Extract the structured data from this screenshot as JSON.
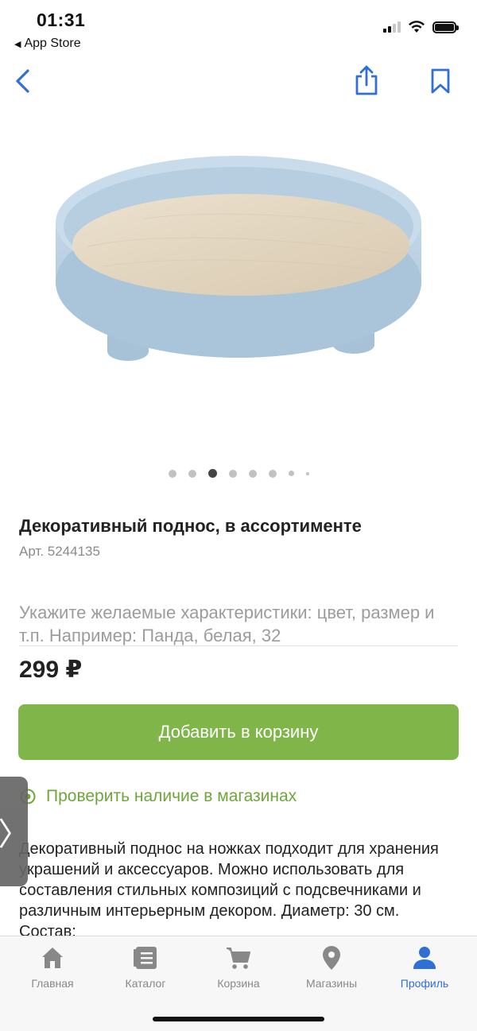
{
  "status_bar": {
    "time": "01:31",
    "back_app": "App Store"
  },
  "nav": {
    "back_icon": "chevron-left-icon",
    "share_icon": "share-icon",
    "bookmark_icon": "bookmark-icon",
    "accent_color": "#2f6fd6"
  },
  "carousel": {
    "total": 8,
    "active_index": 3
  },
  "product": {
    "title": "Декоративный поднос, в ассортименте",
    "article": "Арт. 5244135",
    "characteristics_placeholder": "Укажите желаемые характеристики: цвет, размер и т.п. Например: Панда, белая, 32",
    "price": "299 ₽"
  },
  "actions": {
    "add_to_cart": "Добавить в корзину",
    "check_availability": "Проверить наличие в магазинах",
    "button_color": "#80b54a"
  },
  "description": "Декоративный поднос на ножках подходит для хранения украшений и аксессуаров. Можно использовать для составления стильных композиций с подсвечниками и различным интерьерным декором. Диаметр: 30 см. Состав:",
  "side_handle": "〉",
  "tab_bar": {
    "tabs": [
      {
        "label": "Главная",
        "icon": "home-icon"
      },
      {
        "label": "Каталог",
        "icon": "catalog-icon"
      },
      {
        "label": "Корзина",
        "icon": "cart-icon"
      },
      {
        "label": "Магазины",
        "icon": "location-pin-icon"
      },
      {
        "label": "Профиль",
        "icon": "profile-icon",
        "active": true
      }
    ]
  }
}
